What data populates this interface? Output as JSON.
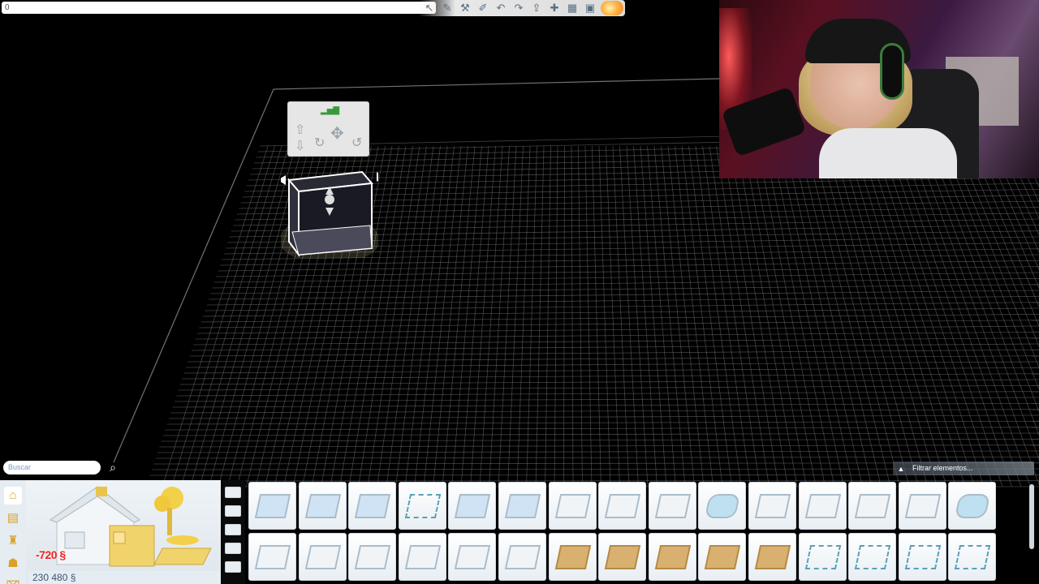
{
  "topbar": {
    "input_value": "0",
    "tools": [
      "pointer-icon",
      "eyedropper-icon",
      "sledgehammer-icon",
      "design-tool-icon",
      "undo-icon",
      "redo-icon",
      "upload-icon",
      "move-icon",
      "lot-icon",
      "camera-icon",
      "day-night-icon"
    ]
  },
  "catalog": {
    "search_placeholder": "Buscar",
    "price_red": "-720 §",
    "funds": "230 480 §",
    "filter_label": "Filtrar elementos...",
    "side_tabs": [
      "house-icon",
      "room-icon",
      "object-icon",
      "furniture-icon",
      "trash-icon"
    ],
    "subcats": [
      "wall-style",
      "floor-style",
      "roof-style",
      "stair-style",
      "misc-style"
    ],
    "items": [
      {
        "kind": "wall"
      },
      {
        "kind": "wall"
      },
      {
        "kind": "wall"
      },
      {
        "kind": "rail"
      },
      {
        "kind": "wall"
      },
      {
        "kind": "wall"
      },
      {
        "kind": "light"
      },
      {
        "kind": "light"
      },
      {
        "kind": "light"
      },
      {
        "kind": "octa"
      },
      {
        "kind": "light"
      },
      {
        "kind": "light"
      },
      {
        "kind": "light"
      },
      {
        "kind": "light"
      },
      {
        "kind": "octa"
      },
      {
        "kind": "light"
      },
      {
        "kind": "light"
      },
      {
        "kind": "light"
      },
      {
        "kind": "light"
      },
      {
        "kind": "light"
      },
      {
        "kind": "light"
      },
      {
        "kind": "wood"
      },
      {
        "kind": "wood"
      },
      {
        "kind": "wood"
      },
      {
        "kind": "wood"
      },
      {
        "kind": "wood"
      },
      {
        "kind": "rail"
      },
      {
        "kind": "rail"
      },
      {
        "kind": "rail"
      },
      {
        "kind": "rail"
      }
    ]
  },
  "gizmo": {
    "level_indicator": "▂▅▇"
  },
  "colors": {
    "grid": "#7f7f7f",
    "panel": "#e6edf2",
    "accent_red": "#e22222"
  }
}
